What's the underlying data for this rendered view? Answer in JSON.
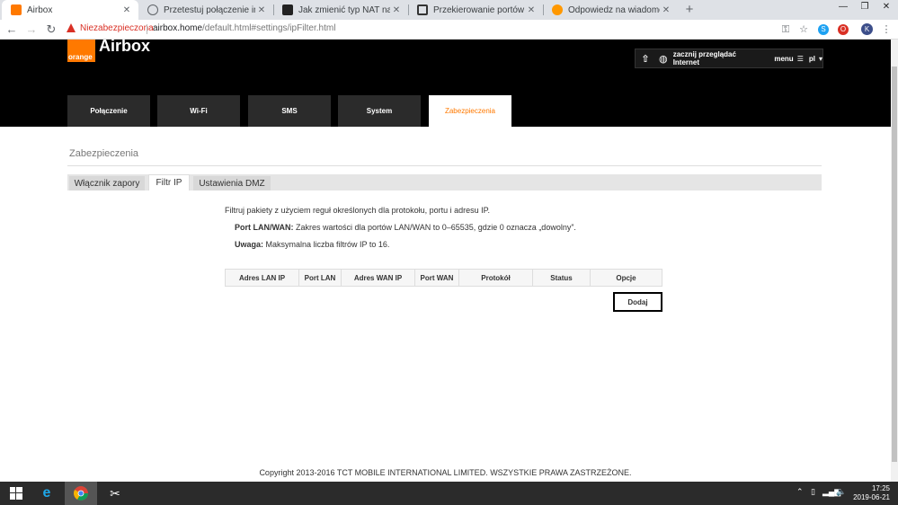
{
  "browser": {
    "tabs": [
      {
        "title": "Airbox",
        "color": "#ff7900"
      },
      {
        "title": "Przetestuj połączenie internetowe",
        "color": "#5f6368"
      },
      {
        "title": "Jak zmienić typ NAT na PlayStation",
        "color": "#222222"
      },
      {
        "title": "Przekierowanie portów LAN, VPN",
        "color": "#333333"
      },
      {
        "title": "Odpowiedz na wiadomość - Nasz",
        "color": "#ff9800"
      }
    ],
    "security_label": "Niezabezpieczona",
    "url_host": "airbox.home",
    "url_path": "/default.html#settings/ipFilter.html",
    "profile_initial": "K"
  },
  "header": {
    "logo_text": "orange",
    "brand": "Airbox",
    "browse_label": "zacznij przeglądać Internet",
    "menu_label": "menu",
    "lang_label": "pl",
    "nav_tabs": [
      "Połączenie",
      "Wi-Fi",
      "SMS",
      "System",
      "Zabezpieczenia"
    ],
    "active_nav": "Zabezpieczenia",
    "accent_color": "#ff7900"
  },
  "main": {
    "page_title": "Zabezpieczenia",
    "sub_tabs": [
      "Włącznik zapory",
      "Filtr IP",
      "Ustawienia DMZ"
    ],
    "active_sub_tab": "Filtr IP",
    "description": "Filtruj pakiety z użyciem reguł określonych dla protokołu, portu i adresu IP.",
    "port_label": "Port LAN/WAN:",
    "port_text": "Zakres wartości dla portów LAN/WAN to 0–65535, gdzie 0 oznacza „dowolny”.",
    "note_label": "Uwaga:",
    "note_text": "Maksymalna liczba filtrów IP to 16.",
    "table_headers": [
      "Adres LAN IP",
      "Port LAN",
      "Adres WAN IP",
      "Port WAN",
      "Protokół",
      "Status",
      "Opcje"
    ],
    "add_button": "Dodaj",
    "copyright": "Copyright 2013-2016 TCT MOBILE INTERNATIONAL LIMITED. WSZYSTKIE PRAWA ZASTRZEŻONE."
  },
  "taskbar": {
    "time": "17:25",
    "date": "2019-06-21"
  }
}
